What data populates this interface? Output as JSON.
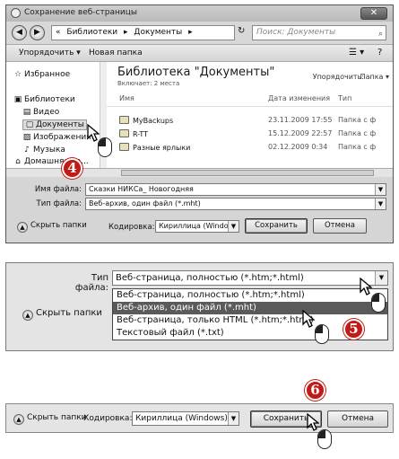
{
  "dialog": {
    "title": "Сохранение веб-страницы",
    "close_glyph": "✕",
    "address": {
      "crumbs": [
        "«",
        "Библиотеки",
        "▸",
        "Документы",
        "▸"
      ],
      "back_glyph": "◀",
      "forward_glyph": "▶",
      "refresh_glyph": "↻",
      "search_placeholder": "Поиск: Документы",
      "search_glyph": "⌕"
    },
    "toolbar": {
      "organize_label": "Упорядочить ▾",
      "new_folder_label": "Новая папка",
      "view_glyph": "☰ ▾",
      "help_glyph": "?"
    },
    "nav": {
      "items": [
        {
          "icon": "☆",
          "label": "Избранное"
        },
        {
          "icon": "▣",
          "label": "Библиотеки"
        },
        {
          "icon": "▤",
          "label": "Видео"
        },
        {
          "icon": "▢",
          "label": "Документы"
        },
        {
          "icon": "▨",
          "label": "Изображения"
        },
        {
          "icon": "♪",
          "label": "Музыка"
        },
        {
          "icon": "⌂",
          "label": "Домашняя гр..."
        }
      ]
    },
    "library": {
      "title": "Библиотека \"Документы\"",
      "subtitle": "Включает: 2 места",
      "sort_label": "Упорядочить:",
      "sort_value": "Папка ▾"
    },
    "files": {
      "columns": [
        "Имя",
        "Дата изменения",
        "Тип"
      ],
      "rows": [
        {
          "name": "MyBackups",
          "date": "23.11.2009 17:55",
          "type": "Папка с ф"
        },
        {
          "name": "R-TT",
          "date": "15.12.2009 22:57",
          "type": "Папка с ф"
        },
        {
          "name": "Разные ярлыки",
          "date": "02.12.2009 0:34",
          "type": "Папка с ф"
        }
      ]
    },
    "form": {
      "filename_label": "Имя файла:",
      "filename_value": "Сказки НИКСа_ Новогодняя",
      "filetype_label": "Тип файла:",
      "filetype_value": "Веб-архив, один файл (*.mht)",
      "hide_folders": "Скрыть папки",
      "encoding_label": "Кодировка:",
      "encoding_value": "Кириллица (Windows)",
      "save_label": "Сохранить",
      "cancel_label": "Отмена"
    }
  },
  "step_panel_2": {
    "filetype_label": "Тип файла:",
    "filetype_value": "Веб-страница, полностью (*.htm;*.html)",
    "hide_folders": "Скрыть папки",
    "options": [
      "Веб-страница, полностью (*.htm;*.html)",
      "Веб-архив, один файл (*.mht)",
      "Веб-страница, только HTML (*.htm;*.html)",
      "Текстовый файл (*.txt)"
    ],
    "selected_index": 1
  },
  "step_panel_3": {
    "hide_folders": "Скрыть папки",
    "encoding_label": "Кодировка:",
    "encoding_value": "Кириллица (Windows)",
    "save_label": "Сохранить",
    "cancel_label": "Отмена"
  },
  "steps": [
    "4",
    "5",
    "6"
  ],
  "colors": {
    "badge": "#c21b17",
    "selection": "#5a5a5a"
  }
}
